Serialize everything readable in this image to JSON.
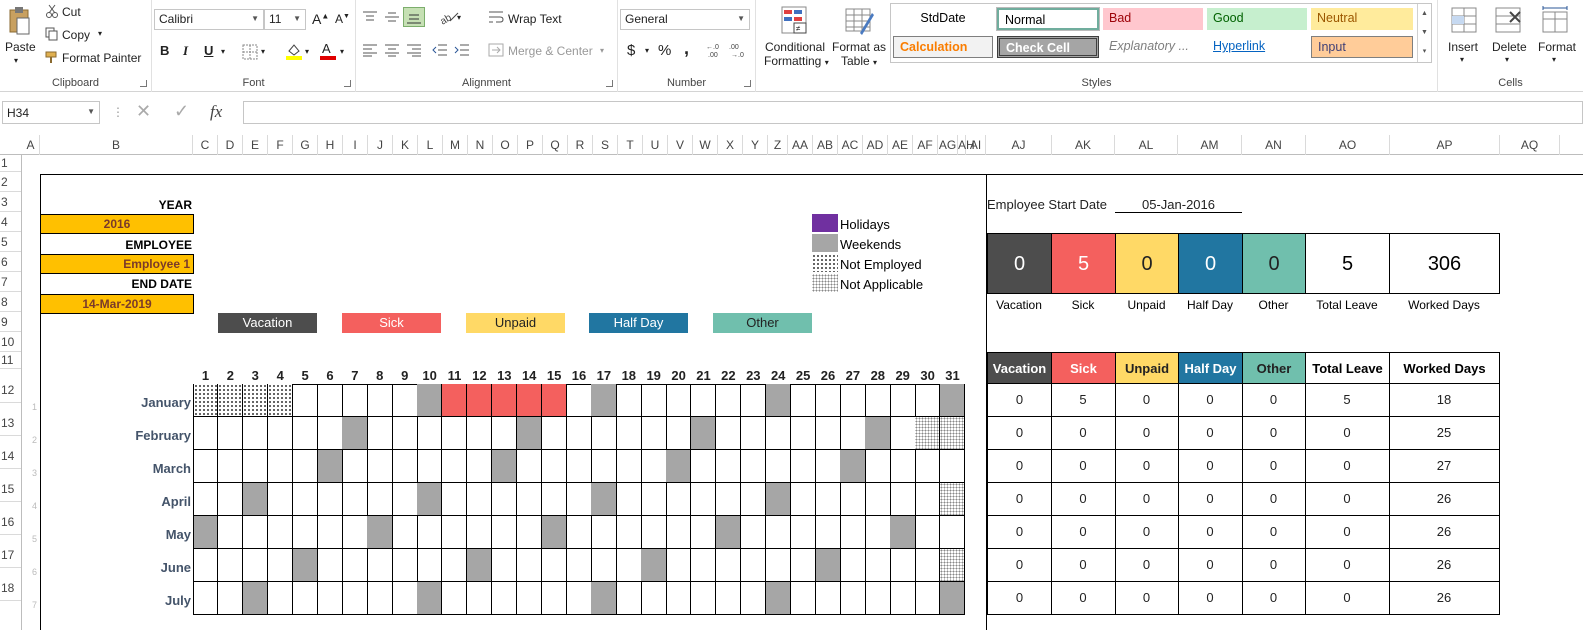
{
  "ribbon": {
    "clipboard": {
      "paste": "Paste",
      "cut": "Cut",
      "copy": "Copy",
      "format_painter": "Format Painter",
      "label": "Clipboard"
    },
    "font": {
      "family": "Calibri",
      "size": "11",
      "label": "Font",
      "bold": "B",
      "italic": "I",
      "underline": "U"
    },
    "alignment": {
      "wrap_text": "Wrap Text",
      "merge_center": "Merge & Center",
      "label": "Alignment"
    },
    "number": {
      "format": "General",
      "currency": "$",
      "percent": "%",
      "comma": ",",
      "label": "Number"
    },
    "styles": {
      "conditional_formatting": "Conditional Formatting",
      "conditional_1": "Conditional",
      "conditional_2": "Formatting",
      "format_as_table_1": "Format as",
      "format_as_table_2": "Table",
      "gallery": [
        {
          "name": "StdDate",
          "bg": "#ffffff",
          "fg": "#000000"
        },
        {
          "name": "Normal",
          "bg": "#ffffff",
          "fg": "#000000"
        },
        {
          "name": "Bad",
          "bg": "#ffc7ce",
          "fg": "#9c0006"
        },
        {
          "name": "Good",
          "bg": "#c6efce",
          "fg": "#006100"
        },
        {
          "name": "Neutral",
          "bg": "#ffeb9c",
          "fg": "#9c5700"
        },
        {
          "name": "Calculation",
          "bg": "#f2f2f2",
          "fg": "#fa7d00"
        },
        {
          "name": "Check Cell",
          "bg": "#a5a5a5",
          "fg": "#ffffff"
        },
        {
          "name": "Explanatory ...",
          "bg": "#ffffff",
          "fg": "#7f7f7f"
        },
        {
          "name": "Hyperlink",
          "bg": "#ffffff",
          "fg": "#0563c1"
        },
        {
          "name": "Input",
          "bg": "#ffcc99",
          "fg": "#3f3f76"
        }
      ],
      "label": "Styles"
    },
    "cells": {
      "insert": "Insert",
      "delete": "Delete",
      "format": "Format",
      "label": "Cells"
    }
  },
  "formula_bar": {
    "name_box": "H34",
    "fx": "fx",
    "value": ""
  },
  "columns": [
    "A",
    "B",
    "C",
    "D",
    "E",
    "F",
    "G",
    "H",
    "I",
    "J",
    "K",
    "L",
    "M",
    "N",
    "O",
    "P",
    "Q",
    "R",
    "S",
    "T",
    "U",
    "V",
    "W",
    "X",
    "Y",
    "Z",
    "AA",
    "AB",
    "AC",
    "AD",
    "AE",
    "AF",
    "AG",
    "AH",
    "AI",
    "AJ",
    "AK",
    "AL",
    "AM",
    "AN",
    "AO",
    "AP",
    "AQ"
  ],
  "rows": [
    "1",
    "2",
    "3",
    "4",
    "5",
    "6",
    "7",
    "8",
    "9",
    "10",
    "11",
    "12",
    "13",
    "14",
    "15",
    "16",
    "17",
    "18"
  ],
  "sheet": {
    "year_label": "YEAR",
    "year_value": "2016",
    "employee_label": "EMPLOYEE",
    "employee_value": "Employee 1",
    "end_date_label": "END DATE",
    "end_date_value": "14-Mar-2019",
    "legend": [
      {
        "label": "Holidays",
        "color": "#7030a0"
      },
      {
        "label": "Weekends",
        "color": "#a6a6a6"
      },
      {
        "label": "Not Employed",
        "color": "dotted"
      },
      {
        "label": "Not Applicable",
        "color": "dotted2"
      }
    ],
    "leave_types": [
      {
        "label": "Vacation",
        "bg": "#4d4d4d",
        "fg": "#ffffff"
      },
      {
        "label": "Sick",
        "bg": "#f4605e",
        "fg": "#ffffff"
      },
      {
        "label": "Unpaid",
        "bg": "#ffd966",
        "fg": "#222222"
      },
      {
        "label": "Half Day",
        "bg": "#2176a1",
        "fg": "#ffffff"
      },
      {
        "label": "Other",
        "bg": "#70bfad",
        "fg": "#222222"
      }
    ],
    "days": [
      "1",
      "2",
      "3",
      "4",
      "5",
      "6",
      "7",
      "8",
      "9",
      "10",
      "11",
      "12",
      "13",
      "14",
      "15",
      "16",
      "17",
      "18",
      "19",
      "20",
      "21",
      "22",
      "23",
      "24",
      "25",
      "26",
      "27",
      "28",
      "29",
      "30",
      "31"
    ],
    "months": [
      {
        "name": "January",
        "idx": "1"
      },
      {
        "name": "February",
        "idx": "2"
      },
      {
        "name": "March",
        "idx": "3"
      },
      {
        "name": "April",
        "idx": "4"
      },
      {
        "name": "May",
        "idx": "5"
      },
      {
        "name": "June",
        "idx": "6"
      },
      {
        "name": "July",
        "idx": "7"
      }
    ],
    "calendar": {
      "January": {
        "weekends": [
          10,
          17,
          24,
          31
        ],
        "sick": [
          11,
          12,
          13,
          14,
          15
        ],
        "not_employed": [
          1,
          2,
          3,
          4
        ],
        "not_applicable": []
      },
      "February": {
        "weekends": [
          7,
          14,
          21,
          28
        ],
        "sick": [],
        "not_employed": [],
        "not_applicable": [
          30,
          31
        ]
      },
      "March": {
        "weekends": [
          6,
          13,
          20,
          27
        ],
        "sick": [],
        "not_employed": [],
        "not_applicable": []
      },
      "April": {
        "weekends": [
          3,
          10,
          17,
          24
        ],
        "sick": [],
        "not_employed": [],
        "not_applicable": [
          31
        ]
      },
      "May": {
        "weekends": [
          1,
          8,
          15,
          22,
          29
        ],
        "sick": [],
        "not_employed": [],
        "not_applicable": []
      },
      "June": {
        "weekends": [
          5,
          12,
          19,
          26
        ],
        "sick": [],
        "not_employed": [],
        "not_applicable": [
          31
        ]
      },
      "July": {
        "weekends": [
          3,
          10,
          17,
          24,
          31
        ],
        "sick": [],
        "not_employed": [],
        "not_applicable": []
      }
    },
    "start_date_label": "Employee Start Date",
    "start_date_value": "05-Jan-2016",
    "summary_cards": [
      {
        "label": "Vacation",
        "value": "0",
        "bg": "#4d4d4d",
        "fg": "#ffffff"
      },
      {
        "label": "Sick",
        "value": "5",
        "bg": "#f4605e",
        "fg": "#ffffff"
      },
      {
        "label": "Unpaid",
        "value": "0",
        "bg": "#ffd966",
        "fg": "#222222"
      },
      {
        "label": "Half Day",
        "value": "0",
        "bg": "#2176a1",
        "fg": "#ffffff"
      },
      {
        "label": "Other",
        "value": "0",
        "bg": "#70bfad",
        "fg": "#222222"
      },
      {
        "label": "Total Leave",
        "value": "5",
        "bg": "#ffffff",
        "fg": "#000000"
      },
      {
        "label": "Worked Days",
        "value": "306",
        "bg": "#ffffff",
        "fg": "#000000"
      }
    ],
    "table_headers": [
      {
        "label": "Vacation",
        "bg": "#4d4d4d",
        "fg": "#ffffff"
      },
      {
        "label": "Sick",
        "bg": "#f4605e",
        "fg": "#ffffff"
      },
      {
        "label": "Unpaid",
        "bg": "#ffd966",
        "fg": "#222222"
      },
      {
        "label": "Half Day",
        "bg": "#2176a1",
        "fg": "#ffffff"
      },
      {
        "label": "Other",
        "bg": "#70bfad",
        "fg": "#222222"
      },
      {
        "label": "Total Leave",
        "bg": "#ffffff",
        "fg": "#000000"
      },
      {
        "label": "Worked Days",
        "bg": "#ffffff",
        "fg": "#000000"
      }
    ],
    "table_rows": [
      [
        "0",
        "5",
        "0",
        "0",
        "0",
        "5",
        "18"
      ],
      [
        "0",
        "0",
        "0",
        "0",
        "0",
        "0",
        "25"
      ],
      [
        "0",
        "0",
        "0",
        "0",
        "0",
        "0",
        "27"
      ],
      [
        "0",
        "0",
        "0",
        "0",
        "0",
        "0",
        "26"
      ],
      [
        "0",
        "0",
        "0",
        "0",
        "0",
        "0",
        "26"
      ],
      [
        "0",
        "0",
        "0",
        "0",
        "0",
        "0",
        "26"
      ],
      [
        "0",
        "0",
        "0",
        "0",
        "0",
        "0",
        "26"
      ]
    ]
  }
}
